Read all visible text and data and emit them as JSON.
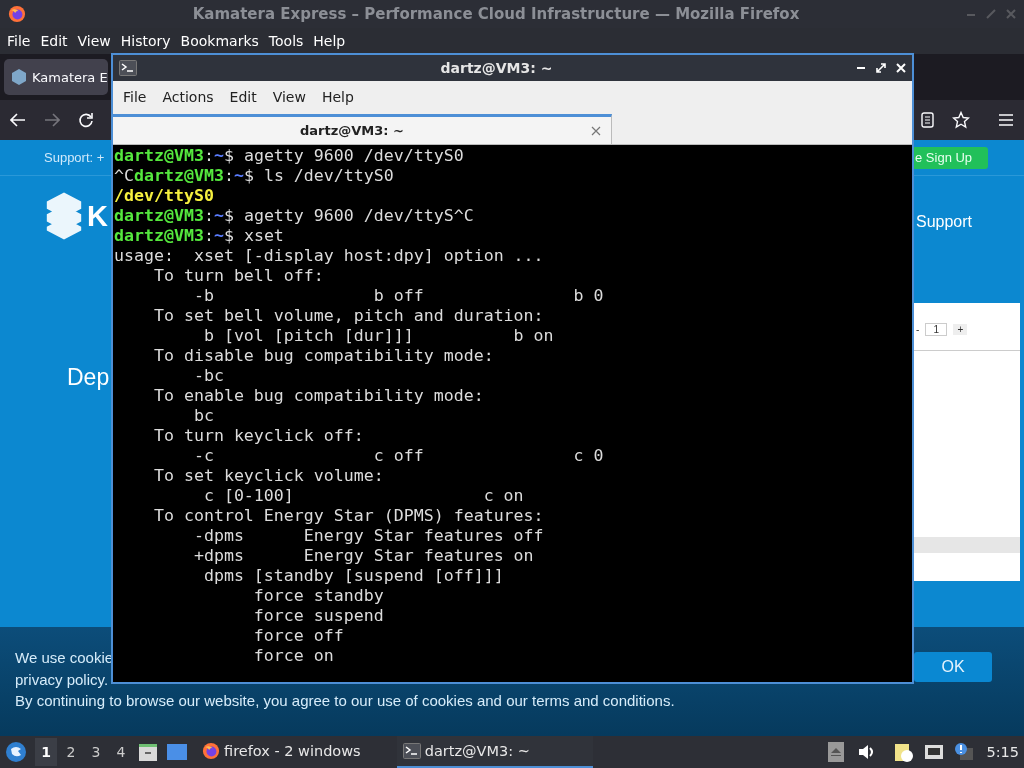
{
  "firefox": {
    "title": "Kamatera Express – Performance Cloud Infrastructure — Mozilla Firefox",
    "menu": [
      "File",
      "Edit",
      "View",
      "History",
      "Bookmarks",
      "Tools",
      "Help"
    ],
    "tab": {
      "label": "Kamatera E",
      "selected": true
    },
    "page": {
      "support_text": "Support: +",
      "signup": "e Sign Up",
      "logo_letter": "K",
      "nav_link": "Support",
      "heading": "Dep",
      "card": {
        "minus": "-",
        "quantity": "1",
        "plus": "+"
      },
      "cookie": {
        "line_1": "We use cookie",
        "line_2": "privacy policy.",
        "line_3": "By continuing to browse our website, you agree to our use of cookies and our terms and conditions.",
        "button": "OK"
      }
    }
  },
  "terminal": {
    "title": "dartz@VM3: ~",
    "menu": [
      "File",
      "Actions",
      "Edit",
      "View",
      "Help"
    ],
    "tabs": [
      {
        "label": "dartz@VM3: ~",
        "selected": true
      }
    ],
    "lines": [
      [
        {
          "kind": "user",
          "text": "dartz@VM3"
        },
        {
          "kind": "plain",
          "text": ":"
        },
        {
          "kind": "path",
          "text": "~"
        },
        {
          "kind": "plain",
          "text": "$ agetty 9600 /dev/ttyS0"
        }
      ],
      [
        {
          "kind": "plain",
          "text": "^C"
        },
        {
          "kind": "user",
          "text": "dartz@VM3"
        },
        {
          "kind": "plain",
          "text": ":"
        },
        {
          "kind": "path",
          "text": "~"
        },
        {
          "kind": "plain",
          "text": "$ ls /dev/ttyS0"
        }
      ],
      [
        {
          "kind": "file",
          "text": "/dev/ttyS0"
        }
      ],
      [
        {
          "kind": "user",
          "text": "dartz@VM3"
        },
        {
          "kind": "plain",
          "text": ":"
        },
        {
          "kind": "path",
          "text": "~"
        },
        {
          "kind": "plain",
          "text": "$ agetty 9600 /dev/ttyS^C"
        }
      ],
      [
        {
          "kind": "user",
          "text": "dartz@VM3"
        },
        {
          "kind": "plain",
          "text": ":"
        },
        {
          "kind": "path",
          "text": "~"
        },
        {
          "kind": "plain",
          "text": "$ xset"
        }
      ],
      [
        {
          "kind": "plain",
          "text": "usage:  xset [-display host:dpy] option ..."
        }
      ],
      [
        {
          "kind": "plain",
          "text": "    To turn bell off:"
        }
      ],
      [
        {
          "kind": "plain",
          "text": "        -b                b off               b 0"
        }
      ],
      [
        {
          "kind": "plain",
          "text": "    To set bell volume, pitch and duration:"
        }
      ],
      [
        {
          "kind": "plain",
          "text": "         b [vol [pitch [dur]]]          b on"
        }
      ],
      [
        {
          "kind": "plain",
          "text": "    To disable bug compatibility mode:"
        }
      ],
      [
        {
          "kind": "plain",
          "text": "        -bc"
        }
      ],
      [
        {
          "kind": "plain",
          "text": "    To enable bug compatibility mode:"
        }
      ],
      [
        {
          "kind": "plain",
          "text": "        bc"
        }
      ],
      [
        {
          "kind": "plain",
          "text": "    To turn keyclick off:"
        }
      ],
      [
        {
          "kind": "plain",
          "text": "        -c                c off               c 0"
        }
      ],
      [
        {
          "kind": "plain",
          "text": "    To set keyclick volume:"
        }
      ],
      [
        {
          "kind": "plain",
          "text": "         c [0-100]                   c on"
        }
      ],
      [
        {
          "kind": "plain",
          "text": "    To control Energy Star (DPMS) features:"
        }
      ],
      [
        {
          "kind": "plain",
          "text": "        -dpms      Energy Star features off"
        }
      ],
      [
        {
          "kind": "plain",
          "text": "        +dpms      Energy Star features on"
        }
      ],
      [
        {
          "kind": "plain",
          "text": "         dpms [standby [suspend [off]]]"
        }
      ],
      [
        {
          "kind": "plain",
          "text": "              force standby"
        }
      ],
      [
        {
          "kind": "plain",
          "text": "              force suspend"
        }
      ],
      [
        {
          "kind": "plain",
          "text": "              force off"
        }
      ],
      [
        {
          "kind": "plain",
          "text": "              force on"
        }
      ]
    ]
  },
  "taskbar": {
    "workspaces": [
      {
        "label": "1",
        "selected": true
      },
      {
        "label": "2",
        "selected": false
      },
      {
        "label": "3",
        "selected": false
      },
      {
        "label": "4",
        "selected": false
      }
    ],
    "tasks": [
      {
        "kind": "firefox",
        "label": "firefox - 2 windows",
        "selected": false
      },
      {
        "kind": "terminal",
        "label": "dartz@VM3: ~",
        "selected": true
      }
    ],
    "clock": "5:15"
  }
}
